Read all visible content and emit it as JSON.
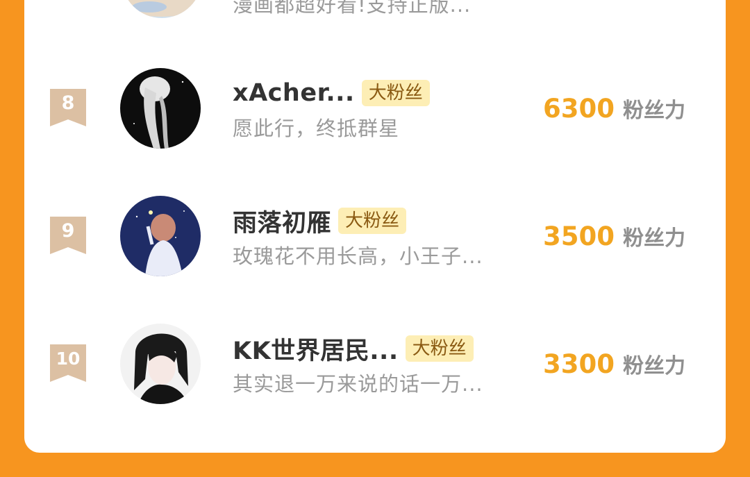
{
  "top_row": {
    "bio": "漫画都超好看!支持正版..."
  },
  "rows": [
    {
      "rank": "8",
      "name": "xAcher...",
      "badge": "大粉丝",
      "bio": "愿此行，终抵群星",
      "score": "6300",
      "score_unit": "粉丝力",
      "avatar": "avatar-white-hair-dark"
    },
    {
      "rank": "9",
      "name": "雨落初雁",
      "badge": "大粉丝",
      "bio": "玫瑰花不用长高，小王子...",
      "score": "3500",
      "score_unit": "粉丝力",
      "avatar": "avatar-girl-starry-night"
    },
    {
      "rank": "10",
      "name": "KK世界居民...",
      "badge": "大粉丝",
      "bio": "其实退一万来说的话一万...",
      "score": "3300",
      "score_unit": "粉丝力",
      "avatar": "avatar-anime-dark-hair"
    }
  ],
  "colors": {
    "page_bg": "#f7951f",
    "card_bg": "#ffffff",
    "score": "#f2a521",
    "rank_ribbon": "#dcc0a3",
    "badge_bg": "#fdeeb5"
  }
}
